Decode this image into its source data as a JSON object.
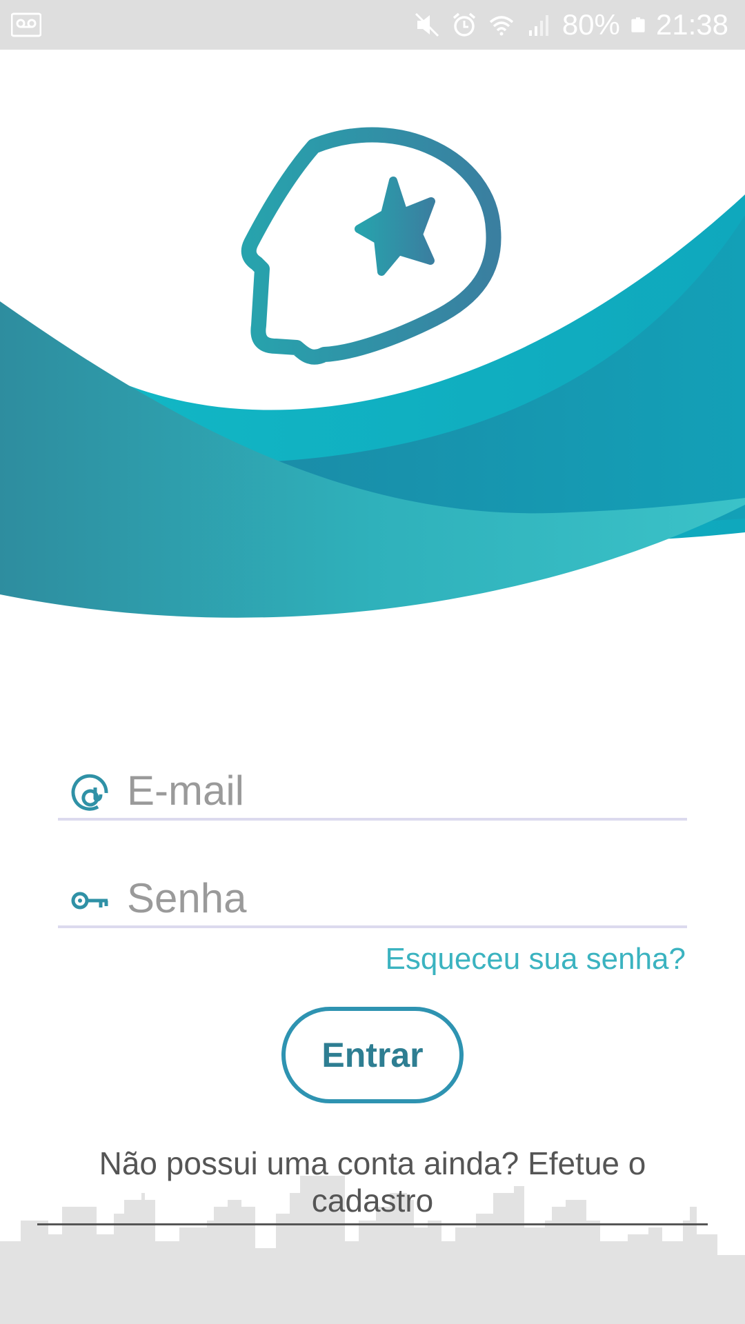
{
  "status_bar": {
    "battery": "80%",
    "time": "21:38",
    "icons": [
      "voicemail-icon",
      "mute-icon",
      "alarm-icon",
      "wifi-icon",
      "signal-icon",
      "battery-icon"
    ]
  },
  "logo": {
    "icon": "brain-star-logo"
  },
  "form": {
    "email": {
      "placeholder": "E-mail",
      "value": "",
      "icon": "at-icon"
    },
    "password": {
      "placeholder": "Senha",
      "value": "",
      "icon": "key-icon"
    },
    "forgot_label": "Esqueceu sua senha?",
    "login_label": "Entrar",
    "register_label": "Não possui uma conta ainda? Efetue o cadastro"
  },
  "colors": {
    "accent": "#3bb3c0",
    "accent_dark": "#2e93b1",
    "status_bar": "#dedede",
    "skyline": "#e2e2e2"
  }
}
